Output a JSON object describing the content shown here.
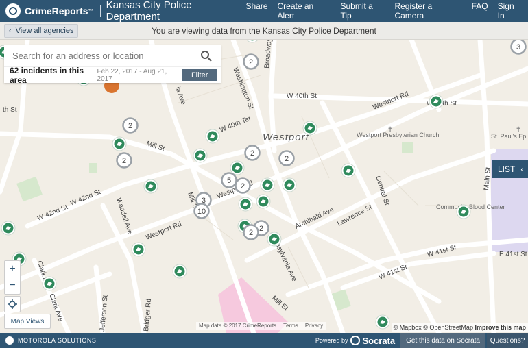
{
  "header": {
    "brand": "CrimeReports",
    "brand_tm": "™",
    "agency": "Kansas City Police Department",
    "nav": [
      "Share",
      "Create an Alert",
      "Submit a Tip",
      "Register a Camera",
      "FAQ",
      "Sign In"
    ]
  },
  "subbar": {
    "back_label": "View all agencies",
    "viewing_text": "You are viewing data from the Kansas City Police Department"
  },
  "search": {
    "placeholder": "Search for an address or location",
    "incidents": "62 incidents in this area",
    "date_range": "Feb 22, 2017 - Aug 21, 2017",
    "filter_label": "Filter"
  },
  "list_tab": {
    "label": "LIST"
  },
  "map_controls": {
    "zoom_in": "+",
    "zoom_out": "−",
    "map_views": "Map Views"
  },
  "map": {
    "neighborhood": "Westport",
    "street_labels": [
      "Washington St",
      "Broadway Blvd",
      "W 40th St",
      "Westport Rd",
      "W 40th St",
      "W 40th Ter",
      "Mill St",
      "Westport Presbyterian Church",
      "St. Paul's Ep Church",
      "Central St",
      "Main St",
      "W 42nd St",
      "W 42nd St",
      "Waddell Ave",
      "Westport Rd",
      "Mill St",
      "Westport Rd",
      "Archibald Ave",
      "Lawrence St",
      "Community Blood Center",
      "W 41st St",
      "W 41st St",
      "E 41st St",
      "Pennsylvania Ave",
      "Clark Ave",
      "Clark Ave",
      "Jefferson St",
      "Bridger Rd",
      "Mill St",
      "th St",
      "ia Ave"
    ],
    "cluster_counts": [
      "2",
      "2",
      "2",
      "2",
      "2",
      "5",
      "2",
      "3",
      "10",
      "2",
      "2",
      "3"
    ]
  },
  "attribution": {
    "left": [
      "Map data © 2017 CrimeReports",
      "Terms",
      "Privacy"
    ],
    "right_prefix": "© Mapbox © OpenStreetMap",
    "right_bold": "Improve this map"
  },
  "footer": {
    "motorola": "MOTOROLA SOLUTIONS",
    "powered_by": "Powered by",
    "socrata": "Socrata",
    "get_data": "Get this data on Socrata",
    "questions": "Questions?"
  },
  "colors": {
    "header_bg": "#2e5573",
    "map_bg": "#f2eee6",
    "road": "#ffffff",
    "incident_marker": "#2f8a5c",
    "cluster_marker": "#9aa0a6",
    "park": "#d6e8cd",
    "pink_area": "#f6c9de",
    "purple_area": "#ddd8f0"
  }
}
